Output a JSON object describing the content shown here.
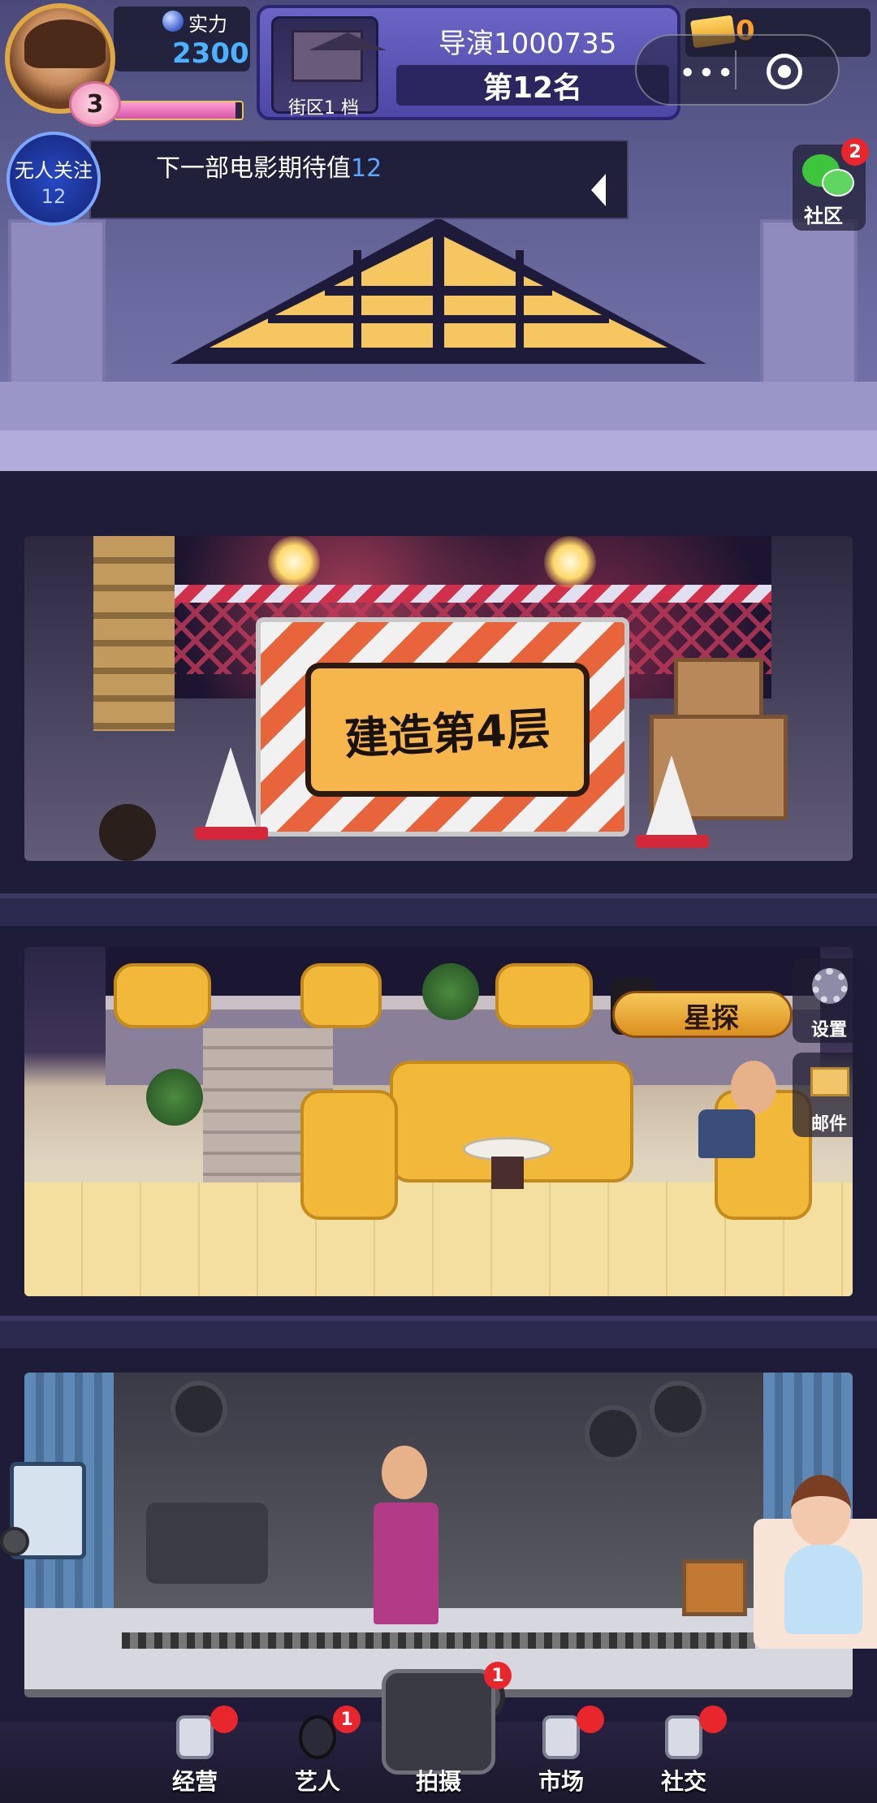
{
  "hud": {
    "power_label": "实力",
    "power_value": "2300",
    "level": "3",
    "exp_fraction": 0.95,
    "district": "街区1  档",
    "director_name": "导演1000735",
    "rank": "第12名",
    "tickets": "0",
    "capsule_more": "•••",
    "followers_label": "无人关注",
    "followers_value": "12",
    "notice_prefix": "下一部电影期待值",
    "notice_value": "12",
    "community_label": "社区",
    "community_badge": "2"
  },
  "floors": {
    "build_label": "建造第4层"
  },
  "side_buttons": {
    "scout_label": "星探",
    "settings_label": "设置",
    "mail_label": "邮件"
  },
  "nav": {
    "items": [
      {
        "label": "经营",
        "badge": ""
      },
      {
        "label": "艺人",
        "badge": "1"
      },
      {
        "label": "拍摄",
        "badge": "1"
      },
      {
        "label": "市场",
        "badge": ""
      },
      {
        "label": "社交",
        "badge": ""
      }
    ]
  },
  "colors": {
    "accent_blue": "#4ab2ff",
    "ticket_orange": "#ff9e2a",
    "badge_red": "#e8262c",
    "panel_purple": "#5a54b8"
  }
}
